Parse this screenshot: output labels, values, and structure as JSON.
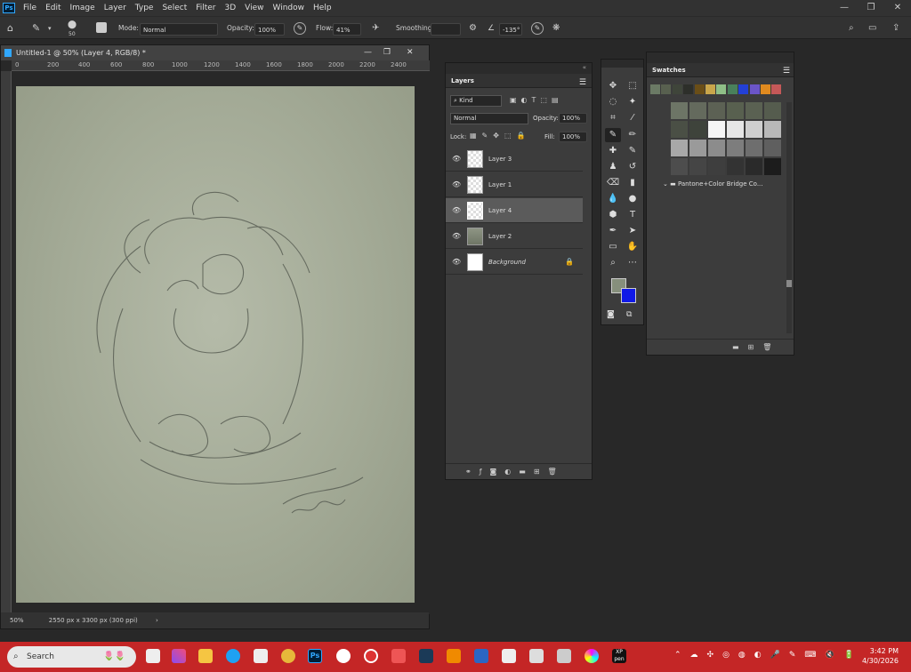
{
  "menubar": {
    "logo": "Ps",
    "items": [
      "File",
      "Edit",
      "Image",
      "Layer",
      "Type",
      "Select",
      "Filter",
      "3D",
      "View",
      "Window",
      "Help"
    ],
    "win": [
      "—",
      "❐",
      "✕"
    ]
  },
  "options": {
    "brush_size": "50",
    "mode_label": "Mode:",
    "mode_value": "Normal",
    "opacity_label": "Opacity:",
    "opacity_value": "100%",
    "flow_label": "Flow:",
    "flow_value": "41%",
    "smoothing_label": "Smoothing:",
    "angle_value": "-135°"
  },
  "document": {
    "tab_title": "Untitled-1 @ 50% (Layer 4, RGB/8) *",
    "ruler_ticks": [
      "0",
      "200",
      "400",
      "600",
      "800",
      "1000",
      "1200",
      "1400",
      "1600",
      "1800",
      "2000",
      "2200",
      "2400"
    ],
    "zoom": "50%",
    "doc_info": "2550 px x 3300 px (300 ppi)"
  },
  "layers": {
    "tab": "Layers",
    "kind_label": "Kind",
    "blend_mode": "Normal",
    "opacity_label": "Opacity:",
    "opacity_value": "100%",
    "lock_label": "Lock:",
    "fill_label": "Fill:",
    "fill_value": "100%",
    "items": [
      {
        "name": "Layer 3"
      },
      {
        "name": "Layer 1"
      },
      {
        "name": "Layer 4"
      },
      {
        "name": "Layer 2"
      },
      {
        "name": "Background"
      }
    ],
    "active_index": 2
  },
  "swatches": {
    "tab": "Swatches",
    "folder_name": "Pantone+Color Bridge Co...",
    "recent": [
      "#6b7a65",
      "#58604f",
      "#3f453a",
      "#2d2f2a",
      "#6a4e17",
      "#c9a64b",
      "#8fbf87",
      "#49805b",
      "#2340d6",
      "#6b55c8",
      "#e08a1f",
      "#c55858"
    ],
    "gray_rows": [
      [
        "#6d7566",
        "#646a5d",
        "#5c6154",
        "#58604f",
        "#5a6152",
        "#555c4e"
      ],
      [
        "#4a4f45",
        "#3e433b",
        "#f5f5f5",
        "#e6e6e6",
        "#cfcfcf",
        "#b8b8b8"
      ],
      [
        "#a8a8a8",
        "#9a9a9a",
        "#8c8c8c",
        "#7d7d7d",
        "#6e6e6e",
        "#5f5f5f"
      ],
      [
        "#4d4d4d",
        "#454545",
        "#3e3e3e",
        "#333333",
        "#2a2a2a",
        "#1c1c1c"
      ]
    ],
    "pantone_rows": [
      [
        "#fff200",
        "#e6007e",
        "#00a0e3",
        "#1d1d1b",
        "#fff48d",
        "#fff59d"
      ],
      [
        "#ffee00",
        "#f5e300",
        "#d9c400",
        "#b5a300",
        "#948200",
        "#fff2a8"
      ],
      [
        "#f6e0a0",
        "#f8d87a",
        "#ffd500",
        "#f2c200",
        "#e8b000",
        "#d99a5a"
      ],
      [
        "#fff06b",
        "#ffe94a",
        "#ffe033",
        "#ffd600",
        "#f5c700",
        "#d9a800"
      ],
      [
        "#c8b000",
        "#e8d200",
        "#ffe566",
        "#ffdd33",
        "#ffd000",
        "#e5a800"
      ],
      [
        "#b38f00",
        "#8a7500",
        "#ffe680",
        "#ffe24d",
        "#ffd11a",
        "#f0b000"
      ],
      [
        "#e0a000",
        "#c98a00",
        "#6b5200",
        "#ffe999",
        "#ffe066",
        "#ffcc00"
      ],
      [
        "#f5a800",
        "#ffb800",
        "#ffc000",
        "#ffd84d",
        "#ffe680",
        "#ffcc33"
      ]
    ]
  },
  "taskbar": {
    "search_placeholder": "Search",
    "time": "3:42 PM",
    "date": "4/30/2026"
  }
}
